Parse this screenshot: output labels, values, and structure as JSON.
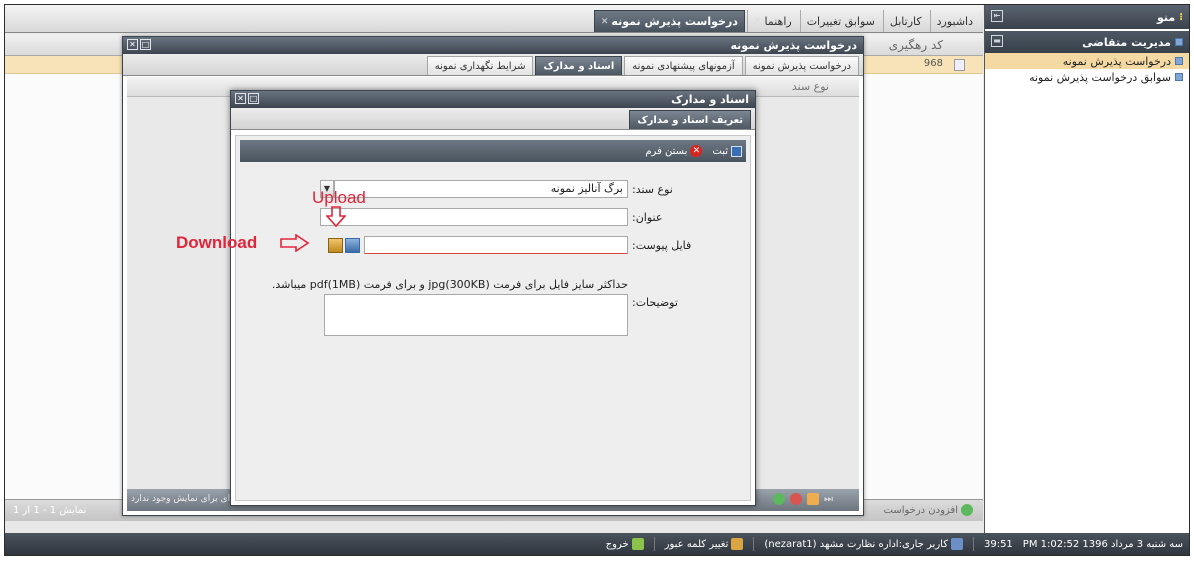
{
  "sidebar": {
    "title": "منو",
    "section": "مدیریت متقاضی",
    "items": [
      {
        "label": "درخواست پذیرش نمونه",
        "active": true
      },
      {
        "label": "سوابق درخواست پذیرش نمونه",
        "active": false
      }
    ]
  },
  "topbar": {
    "tabs": [
      {
        "label": "داشبورد"
      },
      {
        "label": "کارتابل"
      },
      {
        "label": "سوابق تغییرات"
      },
      {
        "label": "راهنما"
      },
      {
        "label": "درخواست پذیرش نمونه"
      }
    ]
  },
  "main": {
    "column": "کد رهگیری",
    "row_value": "968",
    "add_label": "افزودن درخواست",
    "pager": "نمایش 1 - 1 از 1"
  },
  "window1": {
    "title": "درخواست پذیرش نمونه",
    "tabs": [
      {
        "label": "درخواست پذیرش نمونه"
      },
      {
        "label": "آزمونهای پیشنهادی نمونه"
      },
      {
        "label": "اسناد و مدارک"
      },
      {
        "label": "شرایط نگهداری نمونه"
      }
    ],
    "column": "نوع سند",
    "no_data": "ای برای نمایش وجود ندارد"
  },
  "window2": {
    "title": "اسناد و مدارک",
    "tab": "تعریف اسناد و مدارک",
    "save_label": "ثبت",
    "close_label": "بستن فرم",
    "doc_type_label": "نوع سند:",
    "doc_type_value": "برگ آنالیز نمونه",
    "title_label": "عنوان:",
    "attach_label": "فایل پیوست:",
    "note": "حداکثر سایز فایل برای فرمت jpg(300KB) و برای فرمت pdf(1MB) میباشد.",
    "desc_label": "توضیحات:"
  },
  "annotations": {
    "download": "Download",
    "upload": "Upload"
  },
  "statusbar": {
    "datetime": "سه شنبه 3 مرداد 1396  PM 1:02:52",
    "timer": "39:51",
    "user": "کاربر جاری:اداره نظارت مشهد (nezarat1)",
    "change_password": "تغییر کلمه عبور",
    "exit": "خروج"
  },
  "colors": {
    "accent": "#4b555f",
    "selected_row": "#f8e3b8",
    "annotation": "#e0263b"
  }
}
